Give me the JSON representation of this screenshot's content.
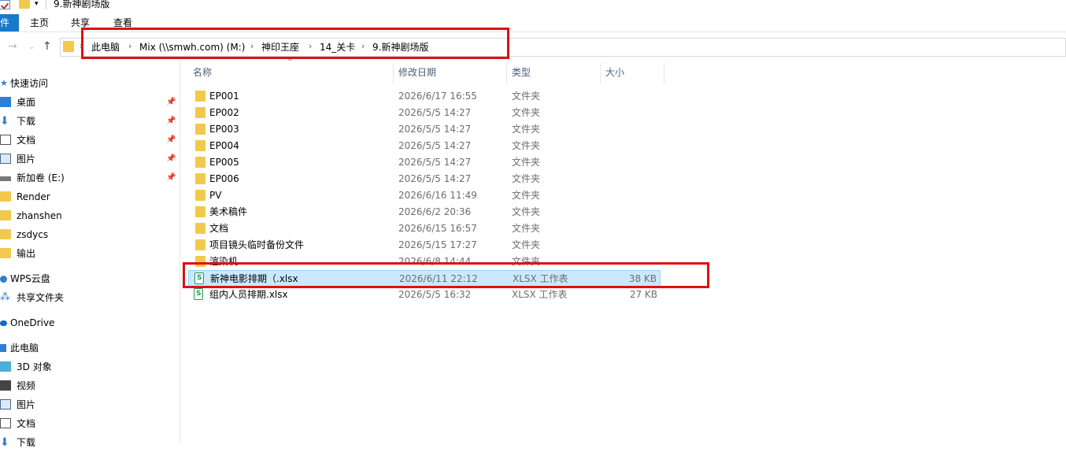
{
  "window": {
    "title": "9.新神剧场版"
  },
  "ribbon": {
    "tabs": [
      "件",
      "主页",
      "共享",
      "查看"
    ]
  },
  "address": {
    "crumbs": [
      "此电脑",
      "Mix (\\\\smwh.com) (M:)",
      "神印王座",
      "14_关卡",
      "9.新神剧场版"
    ],
    "separator": "›"
  },
  "sidebar": {
    "quick_access": "快速访问",
    "pinned": [
      "桌面",
      "下载",
      "文档",
      "图片",
      "新加卷 (E:)"
    ],
    "folders": [
      "Render",
      "zhanshen",
      "zsdycs",
      "输出"
    ],
    "wps": "WPS云盘",
    "shared": "共享文件夹",
    "onedrive": "OneDrive",
    "this_pc": "此电脑",
    "pc_items": [
      "3D 对象",
      "视频",
      "图片",
      "文档",
      "下载"
    ]
  },
  "columns": {
    "name": "名称",
    "modified": "修改日期",
    "type": "类型",
    "size": "大小"
  },
  "files": [
    {
      "name": "EP001",
      "date": "2026/6/17 16:55",
      "type": "文件夹",
      "size": "",
      "kind": "folder"
    },
    {
      "name": "EP002",
      "date": "2026/5/5 14:27",
      "type": "文件夹",
      "size": "",
      "kind": "folder"
    },
    {
      "name": "EP003",
      "date": "2026/5/5 14:27",
      "type": "文件夹",
      "size": "",
      "kind": "folder"
    },
    {
      "name": "EP004",
      "date": "2026/5/5 14:27",
      "type": "文件夹",
      "size": "",
      "kind": "folder"
    },
    {
      "name": "EP005",
      "date": "2026/5/5 14:27",
      "type": "文件夹",
      "size": "",
      "kind": "folder"
    },
    {
      "name": "EP006",
      "date": "2026/5/5 14:27",
      "type": "文件夹",
      "size": "",
      "kind": "folder"
    },
    {
      "name": "PV",
      "date": "2026/6/16 11:49",
      "type": "文件夹",
      "size": "",
      "kind": "folder"
    },
    {
      "name": "美术稿件",
      "date": "2026/6/2 20:36",
      "type": "文件夹",
      "size": "",
      "kind": "folder"
    },
    {
      "name": "文档",
      "date": "2026/6/15 16:57",
      "type": "文件夹",
      "size": "",
      "kind": "folder"
    },
    {
      "name": "项目镜头临时备份文件",
      "date": "2026/5/15 17:27",
      "type": "文件夹",
      "size": "",
      "kind": "folder"
    },
    {
      "name": "渲染机",
      "date": "2026/6/8 14:44",
      "type": "文件夹",
      "size": "",
      "kind": "folder"
    },
    {
      "name": "新神电影排期（.xlsx",
      "date": "2026/6/11 22:12",
      "type": "XLSX 工作表",
      "size": "38 KB",
      "kind": "xlsx",
      "selected": true
    },
    {
      "name": "组内人员排期.xlsx",
      "date": "2026/5/5 16:32",
      "type": "XLSX 工作表",
      "size": "27 KB",
      "kind": "xlsx"
    }
  ],
  "colors": {
    "selection": "#cce8ff",
    "highlight": "#e01010",
    "file_tab": "#1979ca"
  }
}
